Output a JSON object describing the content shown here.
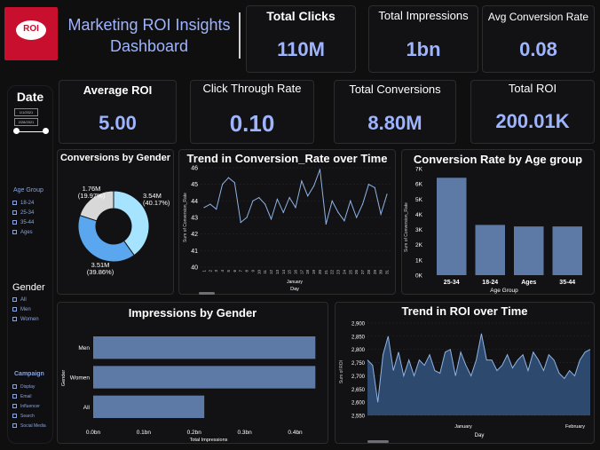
{
  "header": {
    "logo_text": "ROI",
    "title_line1": "Marketing ROI Insights",
    "title_line2": "Dashboard"
  },
  "kpis_top": [
    {
      "label": "Total Clicks",
      "value": "110M"
    },
    {
      "label": "Total Impressions",
      "value": "1bn"
    },
    {
      "label": "Avg Conversion Rate",
      "value": "0.08"
    }
  ],
  "kpis_row2": [
    {
      "label": "Average ROI",
      "value": "5.00"
    },
    {
      "label": "Click Through Rate",
      "value": "0.10"
    },
    {
      "label": "Total Conversions",
      "value": "8.80M"
    },
    {
      "label": "Total ROI",
      "value": "200.01K"
    }
  ],
  "sidebar": {
    "date_label": "Date",
    "date_from": "1/1/2021",
    "date_to": "2/28/2021",
    "age_group_label": "Age Group",
    "age_groups": [
      "18-24",
      "25-34",
      "35-44",
      "Ages"
    ],
    "gender_label": "Gender",
    "genders": [
      "All",
      "Men",
      "Women"
    ],
    "campaign_label": "Campaign",
    "campaigns": [
      "Display",
      "Email",
      "Influencer",
      "Search",
      "Social Media"
    ]
  },
  "colors": {
    "accent": "#9fb4ff",
    "bar": "#5d7aa6",
    "line": "#8fb3e6",
    "area": "#32557e",
    "donut": [
      "#a6e3ff",
      "#5aa7f0",
      "#d8d8d8"
    ],
    "logo_red": "#c8102e"
  },
  "chart_data": [
    {
      "type": "pie",
      "title": "Conversions by Gender",
      "slices": [
        {
          "label": "3.54M",
          "pct": "(40.17%)",
          "value": 3.54
        },
        {
          "label": "3.51M",
          "pct": "(39.86%)",
          "value": 3.51
        },
        {
          "label": "1.76M",
          "pct": "(19.97%)",
          "value": 1.76
        }
      ]
    },
    {
      "type": "line",
      "title": "Trend in Conversion_Rate over Time",
      "ylabel": "Sum of Conversion_Rate",
      "xlabel": "Day",
      "x_group": "January",
      "ylim": [
        40,
        46
      ],
      "yticks": [
        40,
        41,
        42,
        43,
        44,
        45,
        46
      ],
      "x": [
        1,
        2,
        3,
        4,
        5,
        6,
        7,
        8,
        9,
        10,
        11,
        12,
        13,
        14,
        15,
        16,
        17,
        18,
        19,
        20,
        21,
        22,
        23,
        24,
        25,
        26,
        27,
        28,
        29,
        30,
        31
      ],
      "values": [
        43.6,
        43.8,
        43.5,
        45.0,
        45.4,
        45.1,
        42.7,
        43.0,
        44.0,
        44.2,
        43.8,
        42.9,
        44.1,
        43.3,
        44.2,
        43.6,
        45.2,
        44.3,
        44.9,
        45.9,
        42.6,
        44.0,
        43.3,
        42.8,
        44.0,
        43.0,
        43.8,
        45.0,
        44.8,
        43.2,
        44.4
      ]
    },
    {
      "type": "bar",
      "title": "Conversion Rate by Age group",
      "ylabel": "Sum of Conversion_Rate",
      "xlabel": "Age Group",
      "categories": [
        "25-34",
        "18-24",
        "Ages",
        "35-44"
      ],
      "values": [
        6.4,
        3.3,
        3.2,
        3.2
      ],
      "ylim": [
        0,
        7
      ],
      "yticks": [
        "0K",
        "1K",
        "2K",
        "3K",
        "4K",
        "5K",
        "6K",
        "7K"
      ]
    },
    {
      "type": "bar",
      "orientation": "horizontal",
      "title": "Impressions by Gender",
      "ylabel": "Gender",
      "xlabel": "Total Impressions",
      "categories": [
        "Men",
        "Women",
        "All"
      ],
      "values": [
        0.44,
        0.44,
        0.22
      ],
      "xlim": [
        0,
        0.45
      ],
      "xticks": [
        "0.0bn",
        "0.1bn",
        "0.2bn",
        "0.3bn",
        "0.4bn"
      ]
    },
    {
      "type": "area",
      "title": "Trend in ROI over Time",
      "ylabel": "Sum of ROI",
      "xlabel": "Day",
      "x_groups": [
        "January",
        "February"
      ],
      "ylim": [
        2550,
        2900
      ],
      "yticks": [
        "2,550",
        "2,600",
        "2,650",
        "2,700",
        "2,750",
        "2,800",
        "2,850",
        "2,900"
      ],
      "values": [
        2760,
        2740,
        2600,
        2780,
        2850,
        2720,
        2790,
        2700,
        2760,
        2700,
        2760,
        2740,
        2780,
        2720,
        2710,
        2790,
        2800,
        2700,
        2790,
        2740,
        2700,
        2760,
        2860,
        2760,
        2760,
        2720,
        2740,
        2780,
        2730,
        2760,
        2780,
        2720,
        2790,
        2760,
        2720,
        2780,
        2760,
        2710,
        2690,
        2720,
        2700,
        2760,
        2790,
        2800
      ]
    }
  ]
}
